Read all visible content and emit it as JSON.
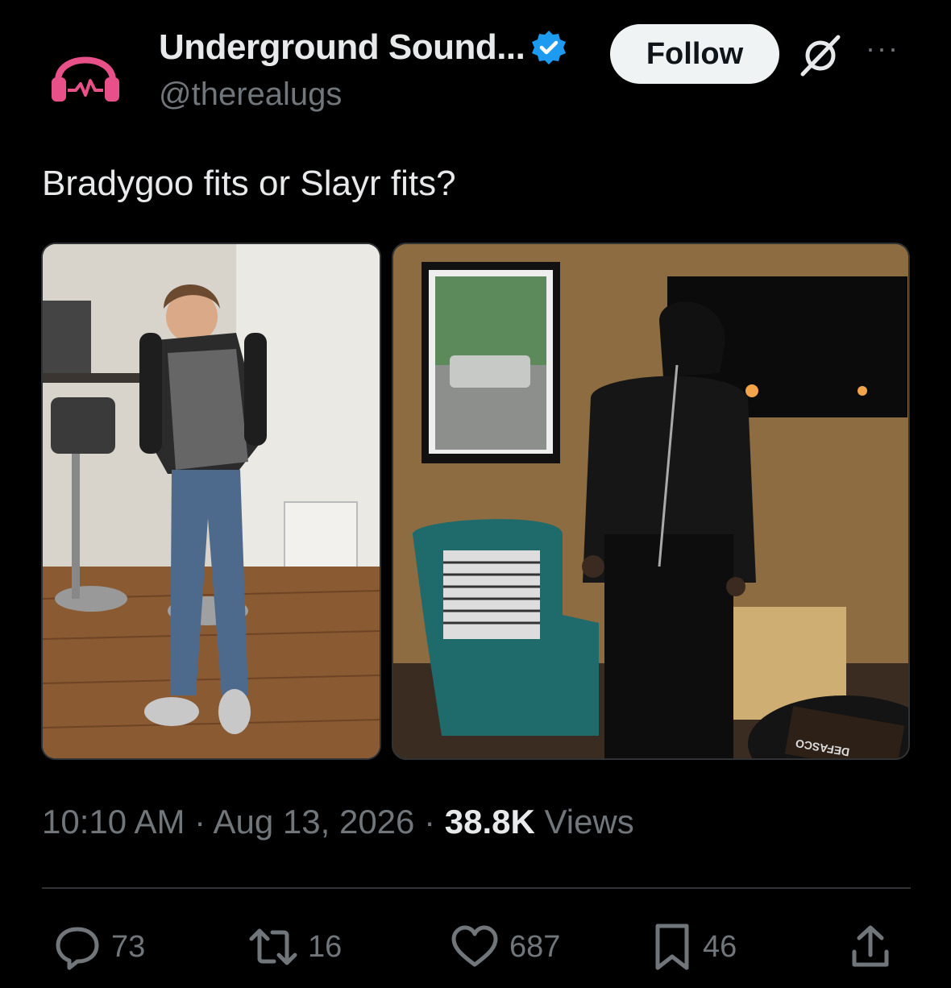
{
  "account": {
    "display_name": "Underground Sound...",
    "handle": "@therealugs",
    "brand_color": "#e8508a",
    "verified_color": "#1d9bf0"
  },
  "header": {
    "follow_label": "Follow",
    "grok_icon": "grok-icon",
    "more_label": "···"
  },
  "tweet": {
    "text": "Bradygoo fits or Slayr fits?",
    "media": [
      {
        "name": "photo-left",
        "description_icon": "image"
      },
      {
        "name": "photo-right",
        "description_icon": "image",
        "book_text": "DEFASCO"
      }
    ],
    "time": "10:10 AM",
    "date": "Aug 13, 2026",
    "views_count": "38.8K",
    "views_label": "Views",
    "sep": "·"
  },
  "actions": {
    "replies": "73",
    "reposts": "16",
    "likes": "687",
    "bookmarks": "46"
  }
}
